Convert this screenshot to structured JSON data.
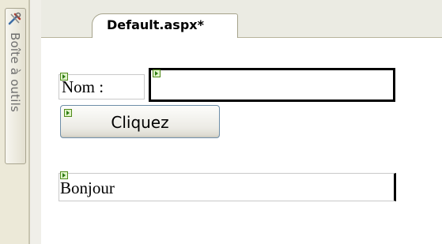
{
  "toolbox": {
    "label": "Boîte à outils",
    "icon": "toolbox-icon"
  },
  "tabs": [
    {
      "label": "Default.aspx*"
    }
  ],
  "form": {
    "label_nom": "Nom :",
    "textbox_value": "",
    "button_label": "Cliquez",
    "label_bonjour": "Bonjour"
  },
  "colors": {
    "marker": "#2e7d14",
    "button_border": "#6e8ea8",
    "tabbar": "#ebebe3"
  }
}
